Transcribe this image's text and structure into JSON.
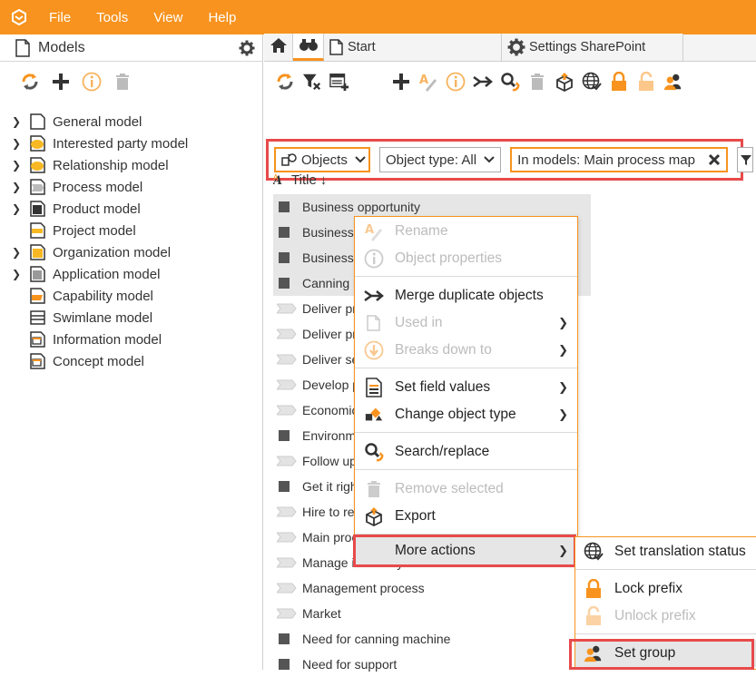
{
  "colors": {
    "accent": "#f7931e",
    "highlight": "#e84a4a"
  },
  "menubar": {
    "items": [
      "File",
      "Tools",
      "View",
      "Help"
    ]
  },
  "left_panel": {
    "title": "Models",
    "tree": [
      {
        "label": "General model",
        "expandable": true,
        "icon": "general-model-icon"
      },
      {
        "label": "Interested party model",
        "expandable": true,
        "icon": "interested-party-icon"
      },
      {
        "label": "Relationship model",
        "expandable": true,
        "icon": "relationship-icon"
      },
      {
        "label": "Process model",
        "expandable": true,
        "icon": "process-icon"
      },
      {
        "label": "Product model",
        "expandable": true,
        "icon": "product-icon"
      },
      {
        "label": "Project model",
        "expandable": false,
        "icon": "project-icon"
      },
      {
        "label": "Organization model",
        "expandable": true,
        "icon": "organization-icon"
      },
      {
        "label": "Application model",
        "expandable": true,
        "icon": "application-icon"
      },
      {
        "label": "Capability model",
        "expandable": false,
        "icon": "capability-icon"
      },
      {
        "label": "Swimlane model",
        "expandable": false,
        "icon": "swimlane-icon"
      },
      {
        "label": "Information model",
        "expandable": false,
        "icon": "information-icon"
      },
      {
        "label": "Concept model",
        "expandable": false,
        "icon": "concept-icon"
      }
    ]
  },
  "tabs": {
    "start": "Start",
    "settings": "Settings SharePoint"
  },
  "filters": {
    "objects": "Objects",
    "object_type": "Object type: All",
    "in_models": "In models: Main process map"
  },
  "list": {
    "column_title": "Title",
    "sort": "↓",
    "rows": [
      {
        "label": "Business opportunity",
        "type": "square",
        "selected": true
      },
      {
        "label": "Business",
        "type": "square",
        "selected": true
      },
      {
        "label": "Business",
        "type": "square",
        "selected": true
      },
      {
        "label": "Canning m",
        "type": "square",
        "selected": true
      },
      {
        "label": "Deliver pr",
        "type": "chevron",
        "selected": false
      },
      {
        "label": "Deliver pr",
        "type": "chevron",
        "selected": false
      },
      {
        "label": "Deliver se",
        "type": "chevron",
        "selected": false
      },
      {
        "label": "Develop p",
        "type": "chevron",
        "selected": false
      },
      {
        "label": "Economic",
        "type": "chevron",
        "selected": false
      },
      {
        "label": "Environm",
        "type": "square",
        "selected": false
      },
      {
        "label": "Follow up",
        "type": "chevron",
        "selected": false
      },
      {
        "label": "Get it righ",
        "type": "square",
        "selected": false
      },
      {
        "label": "Hire to ret",
        "type": "chevron",
        "selected": false
      },
      {
        "label": "Main proc",
        "type": "chevron",
        "selected": false
      },
      {
        "label": "Manage inventory",
        "type": "chevron",
        "selected": false
      },
      {
        "label": "Management process",
        "type": "chevron",
        "selected": false
      },
      {
        "label": "Market",
        "type": "chevron",
        "selected": false
      },
      {
        "label": "Need for canning machine",
        "type": "square",
        "selected": false
      },
      {
        "label": "Need for support",
        "type": "square",
        "selected": false
      }
    ]
  },
  "context_menu": {
    "rename": "Rename",
    "object_properties": "Object properties",
    "merge": "Merge duplicate objects",
    "used_in": "Used in",
    "breaks_down_to": "Breaks down to",
    "set_field_values": "Set field values",
    "change_object_type": "Change object type",
    "search_replace": "Search/replace",
    "remove_selected": "Remove selected",
    "export": "Export",
    "more_actions": "More actions"
  },
  "submenu": {
    "set_translation_status": "Set translation status",
    "lock_prefix": "Lock prefix",
    "unlock_prefix": "Unlock prefix",
    "set_group": "Set group"
  }
}
